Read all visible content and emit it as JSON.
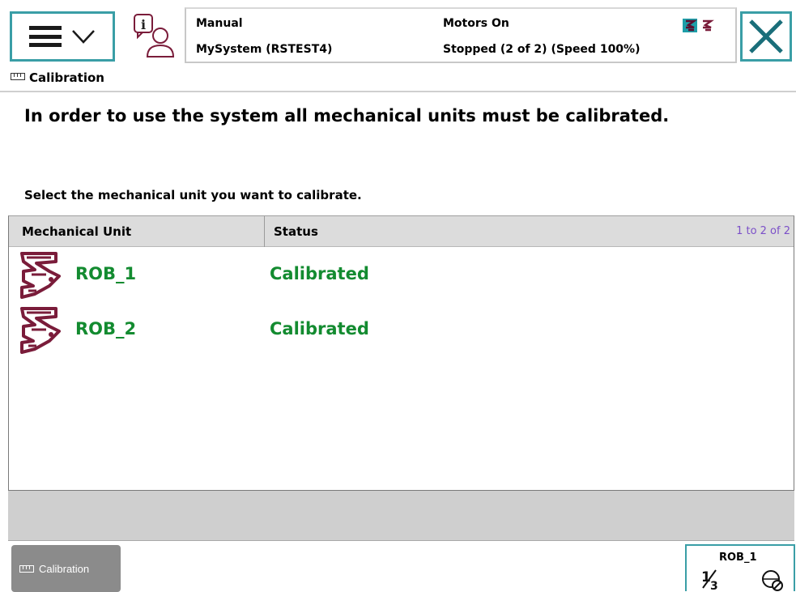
{
  "topbar": {
    "menu_icon": "hamburger-menu-icon",
    "info_icon": "info-user-icon",
    "close_icon": "close-icon",
    "mode": "Manual",
    "system": "MySystem (RSTEST4)",
    "motors": "Motors On",
    "state": "Stopped (2 of 2) (Speed 100%)",
    "status_icons": "robot-status-icons"
  },
  "title": {
    "icon": "ruler-icon",
    "text": "Calibration"
  },
  "content": {
    "headline": "In order to use the system all mechanical units must be calibrated.",
    "instruction": "Select the mechanical unit you want to calibrate."
  },
  "table": {
    "headers": {
      "unit": "Mechanical Unit",
      "status": "Status"
    },
    "count": "1 to 2 of 2",
    "rows": [
      {
        "icon": "robot-arm-icon",
        "name": "ROB_1",
        "status": "Calibrated"
      },
      {
        "icon": "robot-arm-icon",
        "name": "ROB_2",
        "status": "Calibrated"
      }
    ]
  },
  "bottom": {
    "task_label": "Calibration",
    "quickset_unit": "ROB_1",
    "quickset_icons": "increment-and-jog-icons"
  },
  "colors": {
    "accent": "#3a9ea6",
    "ok_text": "#138b30",
    "robot_icon": "#7a1c3a",
    "count_text": "#7b4fc8"
  }
}
